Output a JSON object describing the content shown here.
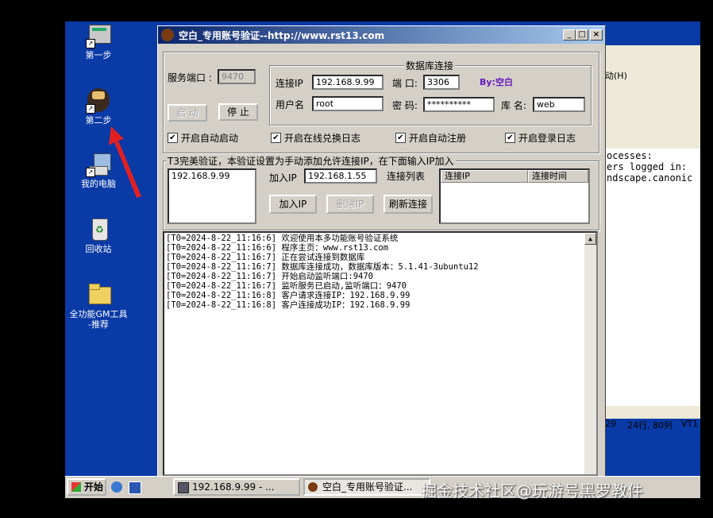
{
  "desktop": {
    "icons": [
      {
        "label": "第一步",
        "icon": "app-shortcut-icon"
      },
      {
        "label": "第二步",
        "icon": "game-shortcut-icon"
      },
      {
        "label": "我的电脑",
        "icon": "computer-icon"
      },
      {
        "label": "回收站",
        "icon": "recycle-bin-icon"
      },
      {
        "label": "全功能GM工具\n-推荐",
        "icon": "folder-icon"
      }
    ]
  },
  "bg_window": {
    "menu_fragment": "动(H)",
    "terminal_lines": [
      "ocesses:",
      "ers logged in:",
      "",
      "ndscape.canonic"
    ],
    "status_a": "29",
    "status_b": "24行, 80列",
    "status_c": "VT1"
  },
  "window": {
    "title": "空白_专用账号验证--http://www.rst13.com",
    "min_label": "_",
    "max_label": "□",
    "close_label": "×",
    "port_label": "服务端口 :",
    "port_value": "9470",
    "start_label": "启 动",
    "stop_label": "停 止",
    "db_group": "数据库连接",
    "ip_label": "连接IP",
    "ip_value": "192.168.9.99",
    "dbport_label": "端 口:",
    "dbport_value": "3306",
    "by_label": "By:空白",
    "user_label": "用户名",
    "user_value": "root",
    "pwd_label": "密 码:",
    "pwd_value": "**********",
    "dbname_label": "库 名:",
    "dbname_value": "web",
    "checks": [
      "开启自动启动",
      "开启在线兑换日志",
      "开启自动注册",
      "开启登录日志"
    ],
    "check_mark": "✔",
    "t3_group": "T3完美验证，本验证设置为手动添加允许连接IP，在下面输入IP加入",
    "allowed_ips": [
      "192.168.9.99"
    ],
    "add_ip_label": "加入IP",
    "add_ip_value": "192.168.1.55",
    "conn_list_label": "连接列表",
    "add_ip_btn": "加入IP",
    "del_ip_btn": "删除IP",
    "refresh_btn": "刷新连接",
    "col_ip": "连接IP",
    "col_time": "连接时间",
    "log": [
      "[T0=2024-8-22_11:16:6] 欢迎使用本多功能账号验证系统",
      "[T0=2024-8-22_11:16:6] 程序主页：www.rst13.com",
      "[T0=2024-8-22_11:16:7] 正在尝试连接到数据库",
      "[T0=2024-8-22_11:16:7] 数据库连接成功，数据库版本：5.1.41-3ubuntu12",
      "[T0=2024-8-22_11:16:7] 开始启动监听端口:9470",
      "[T0=2024-8-22_11:16:7] 监听服务已启动,监听端口：9470",
      "[T0=2024-8-22_11:16:8] 客户请求连接IP：192.168.9.99",
      "[T0=2024-8-22_11:16:8] 客户连接成功IP：192.168.9.99"
    ],
    "scroll_up": "▲"
  },
  "taskbar": {
    "start_label": "开始",
    "items": [
      "192.168.9.99 - ...",
      "空白_专用账号验证..."
    ]
  },
  "watermark": "掘金技术社区@玩游号黑罗教件",
  "colors": {
    "desktop": "#0a3aa6",
    "titlebar": "#0a246a",
    "by": "#6a1bbd"
  }
}
